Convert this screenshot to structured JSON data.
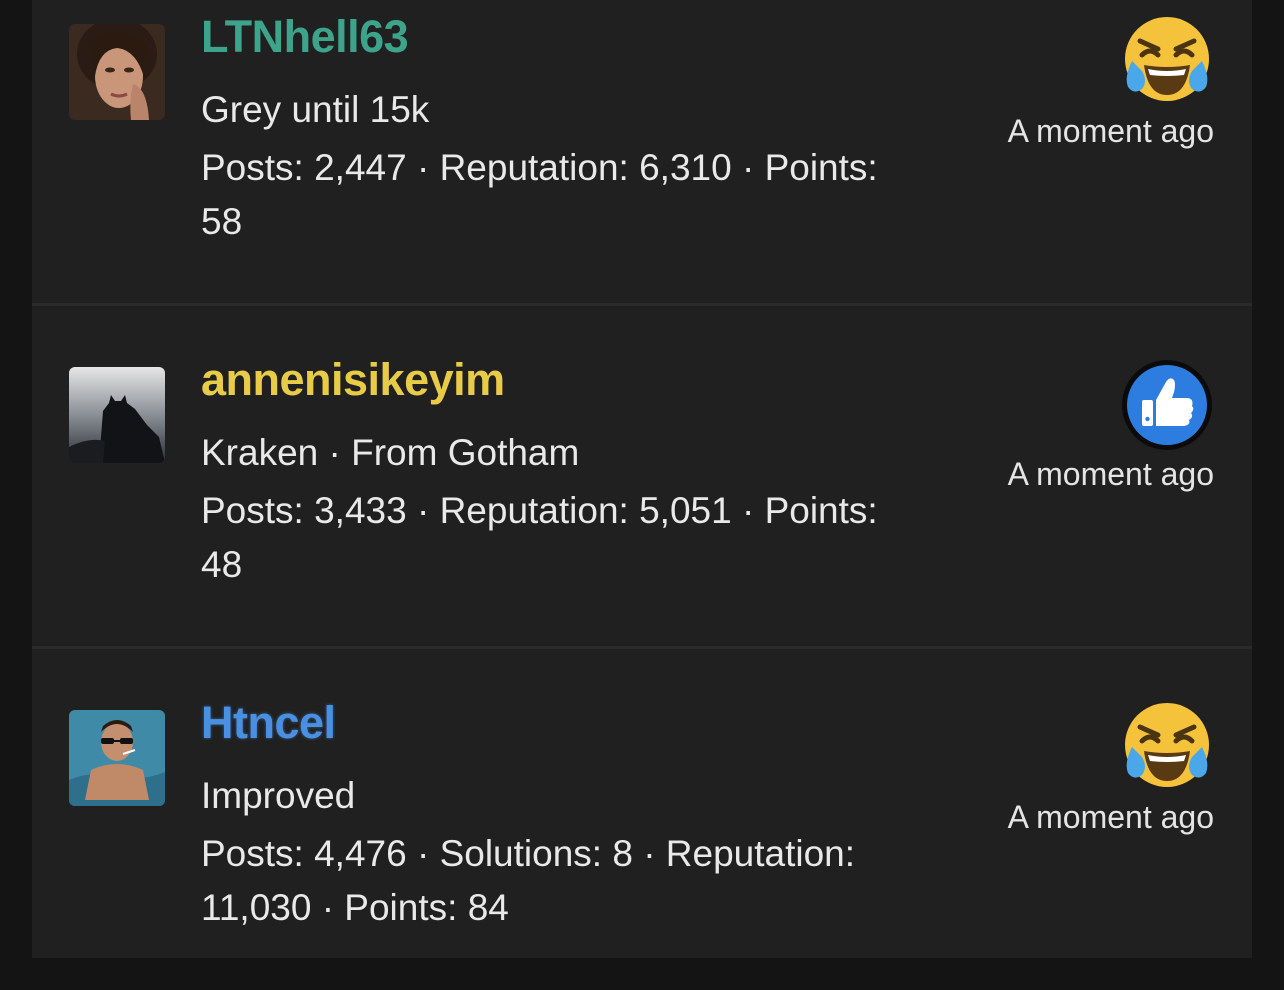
{
  "colors": {
    "background": "#141414",
    "panel": "#202020",
    "username_green": "#3da38b",
    "username_yellow": "#e8cc48",
    "username_blue": "#4a90e2"
  },
  "reactions": [
    {
      "username": "LTNhell63",
      "username_color": "#3da38b",
      "tagline": "Grey until 15k",
      "stats_line1": "Posts: 2,447 · Reputation: 6,310 · Points:",
      "stats_line2": "58",
      "reaction_icon": "laughing-crying-emoji-icon",
      "time": "A moment ago"
    },
    {
      "username": "annenisikeyim",
      "username_color": "#e8cc48",
      "tagline": "Kraken · From Gotham",
      "stats_line1": "Posts: 3,433 · Reputation: 5,051 · Points:",
      "stats_line2": "48",
      "reaction_icon": "thumbs-up-like-icon",
      "time": "A moment ago"
    },
    {
      "username": "Htncel",
      "username_color": "#4a90e2",
      "tagline": "Improved",
      "stats_line1": "Posts: 4,476 · Solutions: 8 · Reputation:",
      "stats_line2": "11,030 · Points: 84",
      "reaction_icon": "laughing-crying-emoji-icon",
      "time": "A moment ago"
    }
  ]
}
